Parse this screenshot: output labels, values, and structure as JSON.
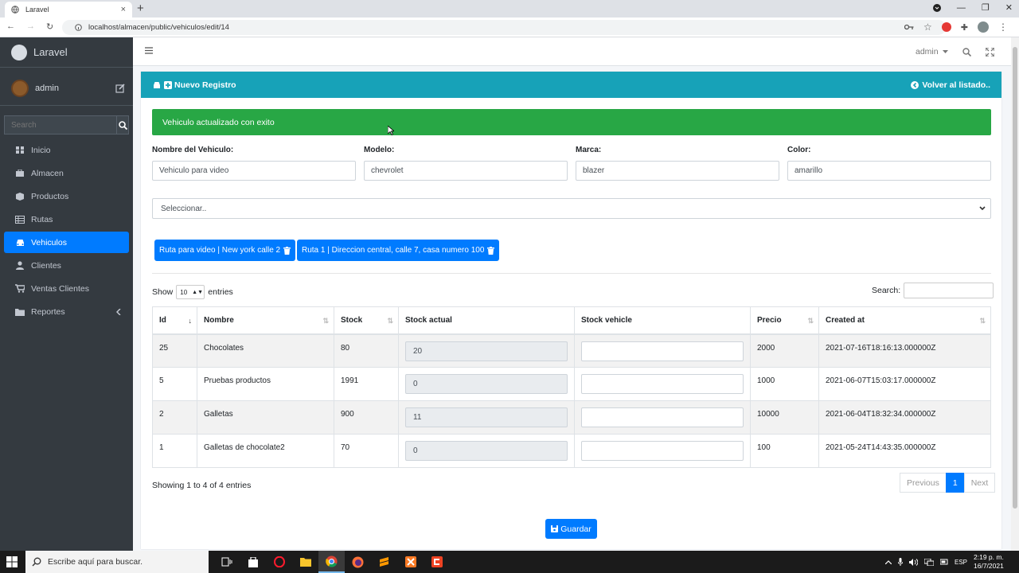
{
  "browser": {
    "tab_title": "Laravel",
    "tab_close": "×",
    "new_tab": "+",
    "url": "localhost/almacen/public/vehiculos/edit/14"
  },
  "sidebar": {
    "brand": "Laravel",
    "user": "admin",
    "search_placeholder": "Search",
    "items": [
      {
        "label": "Inicio",
        "icon": "home-icon"
      },
      {
        "label": "Almacen",
        "icon": "briefcase-icon"
      },
      {
        "label": "Productos",
        "icon": "box-icon"
      },
      {
        "label": "Rutas",
        "icon": "table-icon"
      },
      {
        "label": "Vehiculos",
        "icon": "car-icon",
        "active": true
      },
      {
        "label": "Clientes",
        "icon": "user-icon"
      },
      {
        "label": "Ventas Clientes",
        "icon": "cart-icon"
      },
      {
        "label": "Reportes",
        "icon": "folder-icon"
      }
    ]
  },
  "topnav": {
    "user_menu": "admin"
  },
  "card": {
    "title": "Nuevo Registro",
    "back_link": "Volver al listado..",
    "alert": "Vehiculo actualizado con exito"
  },
  "form": {
    "nombre_label": "Nombre del Vehiculo:",
    "nombre_value": "Vehiculo para video",
    "modelo_label": "Modelo:",
    "modelo_value": "chevrolet",
    "marca_label": "Marca:",
    "marca_value": "blazer",
    "color_label": "Color:",
    "color_value": "amarillo",
    "select_value": "Seleccionar..",
    "routes": [
      "Ruta para video | New york calle 2",
      "Ruta 1 | Direccion central, calle 7, casa numero 100"
    ]
  },
  "datatable": {
    "show_label": "Show",
    "page_size": "10",
    "entries_label": "entries",
    "search_label": "Search:",
    "columns": [
      "Id",
      "Nombre",
      "Stock",
      "Stock actual",
      "Stock vehicle",
      "Precio",
      "Created at"
    ],
    "rows": [
      {
        "id": "25",
        "nombre": "Chocolates",
        "stock": "80",
        "stock_actual": "20",
        "stock_vehicle": "",
        "precio": "2000",
        "created_at": "2021-07-16T18:16:13.000000Z"
      },
      {
        "id": "5",
        "nombre": "Pruebas productos",
        "stock": "1991",
        "stock_actual": "0",
        "stock_vehicle": "",
        "precio": "1000",
        "created_at": "2021-06-07T15:03:17.000000Z"
      },
      {
        "id": "2",
        "nombre": "Galletas",
        "stock": "900",
        "stock_actual": "11",
        "stock_vehicle": "",
        "precio": "10000",
        "created_at": "2021-06-04T18:32:34.000000Z"
      },
      {
        "id": "1",
        "nombre": "Galletas de chocolate2",
        "stock": "70",
        "stock_actual": "0",
        "stock_vehicle": "",
        "precio": "100",
        "created_at": "2021-05-24T14:43:35.000000Z"
      }
    ],
    "info": "Showing 1 to 4 of 4 entries",
    "prev": "Previous",
    "page": "1",
    "next": "Next"
  },
  "save_button": "Guardar",
  "taskbar": {
    "search": "Escribe aquí para buscar.",
    "lang": "ESP",
    "time": "2:19 p. m.",
    "date": "16/7/2021"
  },
  "colors": {
    "sidebar": "#343a40",
    "accent": "#007bff",
    "card_header": "#17a2b8",
    "success": "#28a745"
  }
}
